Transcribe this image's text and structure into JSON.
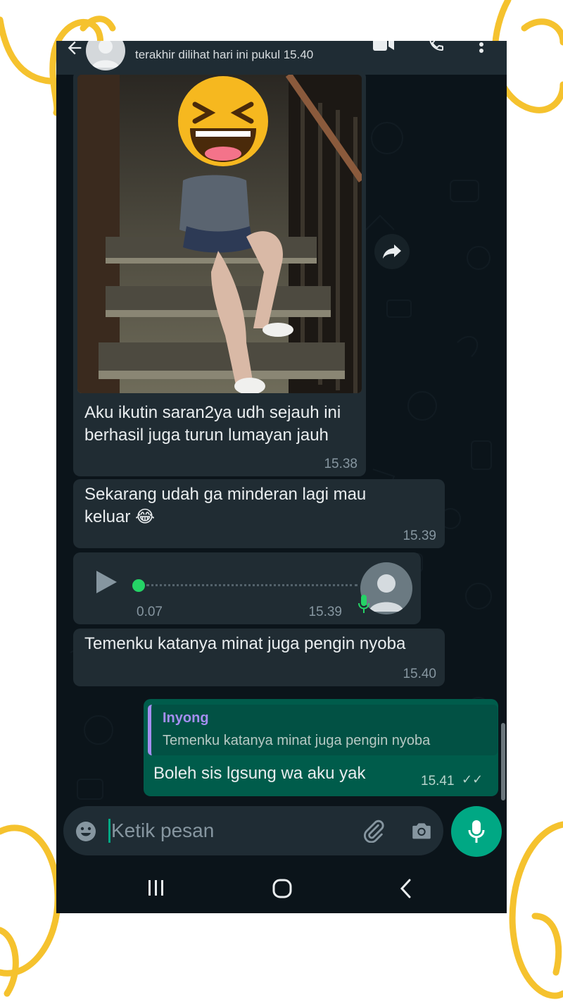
{
  "header": {
    "last_seen": "terakhir dilihat hari ini pukul 15.40",
    "back_icon": "arrow-left-icon",
    "video_icon": "video-call-icon",
    "call_icon": "phone-call-icon",
    "menu_icon": "more-vert-icon"
  },
  "messages": [
    {
      "type": "image",
      "text": "Aku ikutin saran2ya udh sejauh ini berhasil juga turun lumayan jauh",
      "time": "15.38"
    },
    {
      "type": "text",
      "text": "Sekarang udah ga minderan lagi mau keluar",
      "emoji": "😂",
      "time": "15.39"
    },
    {
      "type": "voice",
      "duration": "0.07",
      "time": "15.39"
    },
    {
      "type": "text",
      "text": "Temenku katanya minat juga pengin nyoba",
      "time": "15.40"
    }
  ],
  "outgoing": {
    "quote_name": "Inyong",
    "quote_text": "Temenku katanya minat juga pengin nyoba",
    "text": "Boleh sis lgsung wa aku yak",
    "time": "15.41",
    "ticks": "✓✓"
  },
  "composer": {
    "placeholder": "Ketik pesan"
  },
  "colors": {
    "background": "#0b141a",
    "incoming_bubble": "#202c33",
    "outgoing_bubble": "#005c4b",
    "accent": "#00a884",
    "quote_name": "#a58ef0",
    "decoration": "#f5c22e"
  }
}
